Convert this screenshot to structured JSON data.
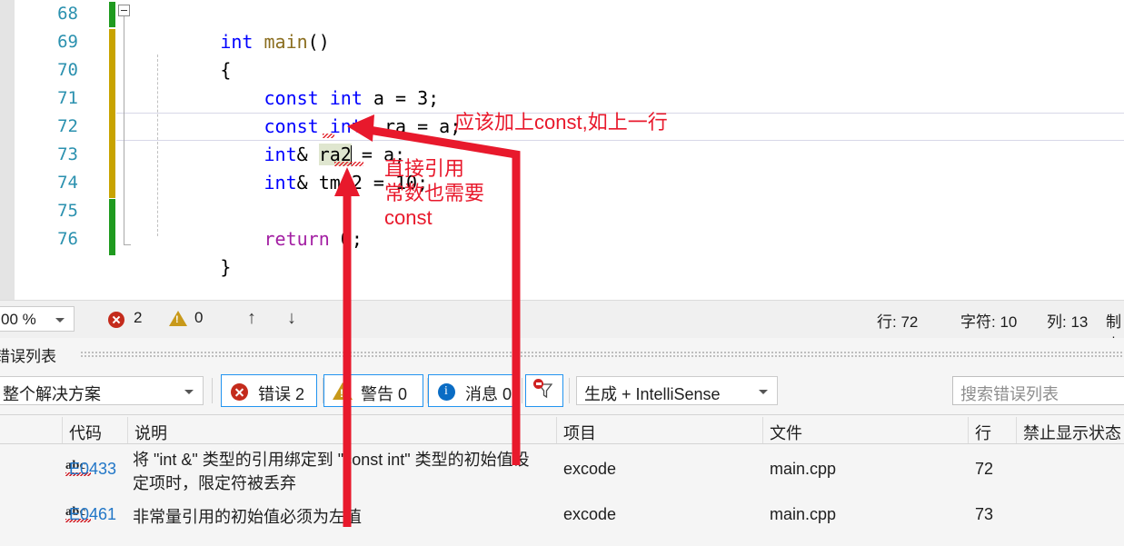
{
  "editor": {
    "lines": [
      {
        "number": "68",
        "tokens": [
          {
            "t": "int",
            "c": "kw"
          },
          {
            "t": " ",
            "c": "pln"
          },
          {
            "t": "main",
            "c": "fn"
          },
          {
            "t": "()",
            "c": "pln"
          }
        ],
        "indent": 0
      },
      {
        "number": "69",
        "tokens": [
          {
            "t": "{",
            "c": "pln"
          }
        ],
        "indent": 0
      },
      {
        "number": "70",
        "tokens": [
          {
            "t": "const",
            "c": "kw"
          },
          {
            "t": " ",
            "c": "pln"
          },
          {
            "t": "int",
            "c": "kw"
          },
          {
            "t": " a = 3;",
            "c": "pln"
          }
        ],
        "indent": 1
      },
      {
        "number": "71",
        "tokens": [
          {
            "t": "const",
            "c": "kw"
          },
          {
            "t": " ",
            "c": "pln"
          },
          {
            "t": "int",
            "c": "kw"
          },
          {
            "t": "& ra = a;",
            "c": "pln"
          }
        ],
        "indent": 1
      },
      {
        "number": "72",
        "tokens": [
          {
            "t": "int",
            "c": "kw"
          },
          {
            "t": "& ",
            "c": "pln"
          },
          {
            "t": "ra2",
            "c": "sel"
          },
          {
            "t": " = a;",
            "c": "pln"
          }
        ],
        "indent": 1
      },
      {
        "number": "73",
        "tokens": [
          {
            "t": "int",
            "c": "kw"
          },
          {
            "t": "& tmp2 = 10;",
            "c": "pln"
          }
        ],
        "indent": 1
      },
      {
        "number": "74",
        "tokens": [],
        "indent": 0
      },
      {
        "number": "75",
        "tokens": [
          {
            "t": "return",
            "c": "ctl"
          },
          {
            "t": " 0;",
            "c": "pln"
          }
        ],
        "indent": 1
      },
      {
        "number": "76",
        "tokens": [
          {
            "t": "}",
            "c": "pln"
          }
        ],
        "indent": 0
      }
    ],
    "code_text": {
      "l68": "int main()",
      "l69": "{",
      "l70": "const int a = 3;",
      "l71": "const int& ra = a;",
      "l72": "int& ra2 = a;",
      "l73": "int& tmp2 = 10;",
      "l74": "",
      "l75": "return 0;",
      "l76": "}"
    },
    "colors": {
      "keyword": "#0000ff",
      "function": "#8a6d1e",
      "control": "#a31fa3",
      "plain": "#000000",
      "linenumber": "#2b91af",
      "changed_track": "#c8a300",
      "saved_track": "#1f9a1f",
      "selection": "#dfe6cf"
    }
  },
  "statusbar": {
    "zoom": "00 %",
    "error_count": "2",
    "warning_count": "0",
    "prev_arrow": "↑",
    "next_arrow": "↓",
    "line_label": "行: 72",
    "char_label": "字符: 10",
    "col_label": "列: 13",
    "tab_label": "制表"
  },
  "panel": {
    "title": "错误列表",
    "scope_selected": "整个解决方案",
    "toggles": [
      {
        "name": "errors",
        "label": "错误 2"
      },
      {
        "name": "warnings",
        "label": "警告 0"
      },
      {
        "name": "messages",
        "label": "消息 0"
      }
    ],
    "build_filter_selected": "生成 + IntelliSense",
    "search_placeholder": "搜索错误列表",
    "columns": [
      "代码",
      "说明",
      "项目",
      "文件",
      "行",
      "禁止显示状态"
    ],
    "rows": [
      {
        "icon": "intellisense-error-icon",
        "code": "E0433",
        "description": "将 \"int &\" 类型的引用绑定到 \"const int\" 类型的初始值设定项时，限定符被丢弃",
        "description_line1": "将 \"int &\" 类型的引用绑定到 \"const int\" 类型的初始值设",
        "description_line2": "定项时，限定符被丢弃",
        "project": "excode",
        "file": "main.cpp",
        "line": "72"
      },
      {
        "icon": "intellisense-error-icon",
        "code": "E0461",
        "description": "非常量引用的初始值必须为左值",
        "description_line1": "非常量引用的初始值必须为左值",
        "description_line2": "",
        "project": "excode",
        "file": "main.cpp",
        "line": "73"
      }
    ]
  },
  "annotations": {
    "color": "#e8192c",
    "top_note": "应该加上const,如上一行",
    "side_note_line1": "直接引用",
    "side_note_line2": "常数也需要",
    "side_note_line3": "const"
  }
}
